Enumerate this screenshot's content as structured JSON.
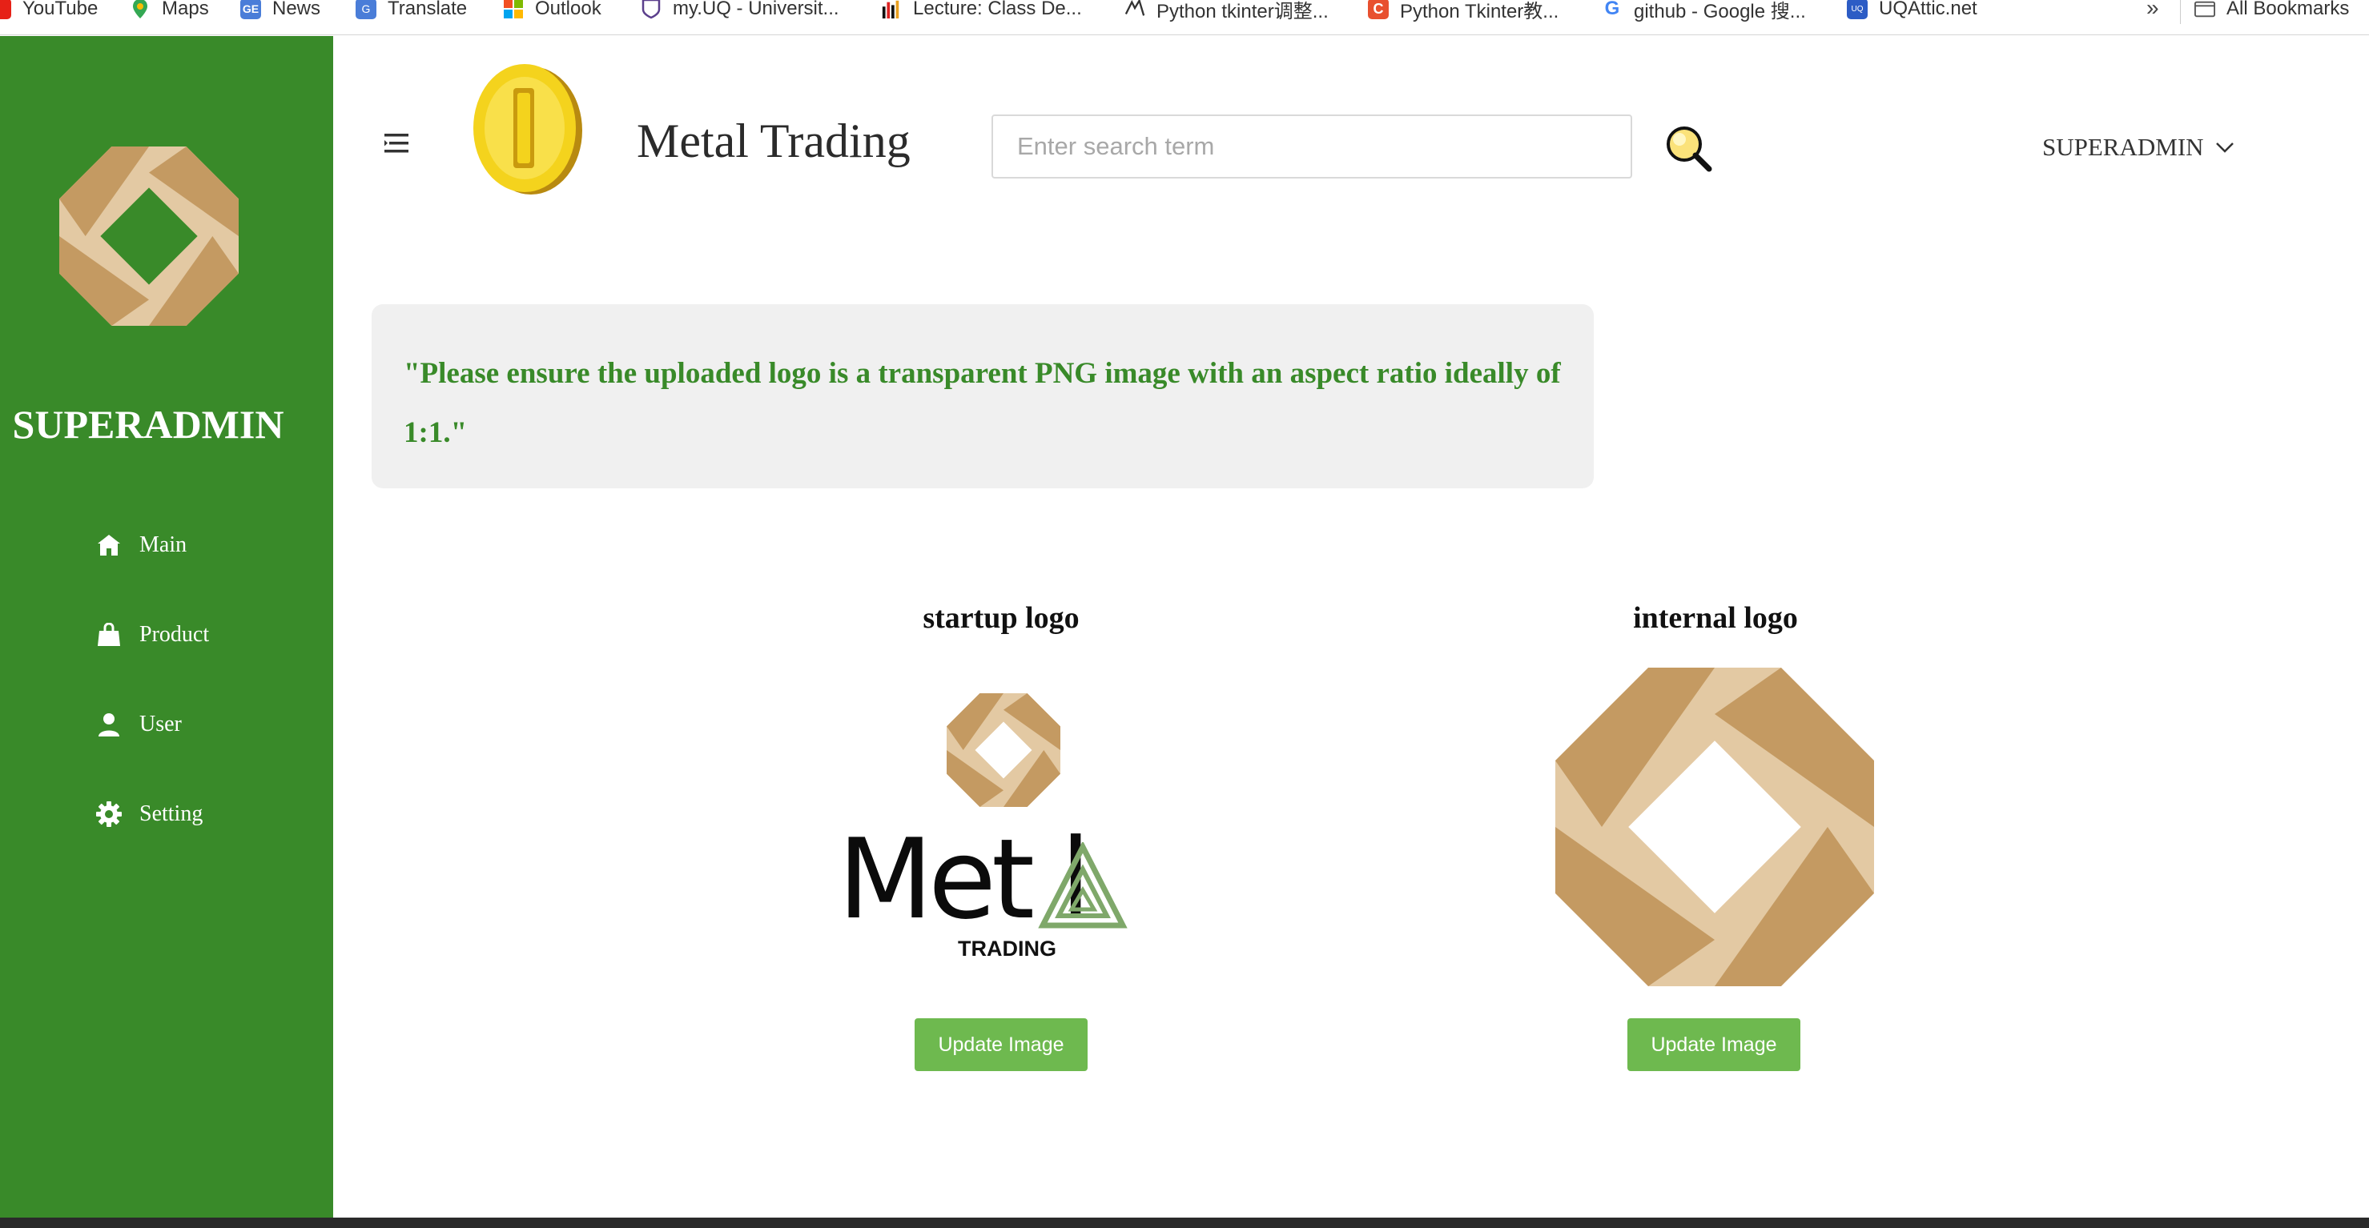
{
  "bookmarks": [
    {
      "label": "YouTube",
      "icon": "youtube-icon"
    },
    {
      "label": "Maps",
      "icon": "maps-icon"
    },
    {
      "label": "News",
      "icon": "news-icon"
    },
    {
      "label": "Translate",
      "icon": "translate-icon"
    },
    {
      "label": "Outlook",
      "icon": "outlook-icon"
    },
    {
      "label": "my.UQ - Universit...",
      "icon": "uq-icon"
    },
    {
      "label": "Lecture: Class De...",
      "icon": "lecture-icon"
    },
    {
      "label": "Python tkinter调整...",
      "icon": "python-icon"
    },
    {
      "label": "Python Tkinter教...",
      "icon": "csdn-icon"
    },
    {
      "label": "github - Google 搜...",
      "icon": "google-icon"
    },
    {
      "label": "UQAttic.net",
      "icon": "uqattic-icon"
    }
  ],
  "bookmarks_more": "»",
  "all_bookmarks": "All Bookmarks",
  "sidebar": {
    "title": "SUPERADMIN",
    "items": [
      {
        "label": "Main",
        "icon": "home-icon"
      },
      {
        "label": "Product",
        "icon": "shopping-bag-icon"
      },
      {
        "label": "User",
        "icon": "user-icon"
      },
      {
        "label": "Setting",
        "icon": "gear-icon"
      }
    ]
  },
  "header": {
    "title": "Metal Trading",
    "search_placeholder": "Enter search term",
    "user_name": "SUPERADMIN"
  },
  "notice": {
    "text": "\"Please ensure the uploaded logo is a transparent PNG image with an aspect ratio ideally of 1:1.\""
  },
  "logos": [
    {
      "title": "startup logo",
      "button_label": "Update Image",
      "wordmark": "Met l",
      "subtext": "TRADING"
    },
    {
      "title": "internal logo",
      "button_label": "Update Image"
    }
  ],
  "colors": {
    "sidebar": "#398a29",
    "notice_text": "#398a29",
    "button": "#6eb94f",
    "logo_light": "#e3c9a3",
    "logo_dark": "#c49a62"
  }
}
